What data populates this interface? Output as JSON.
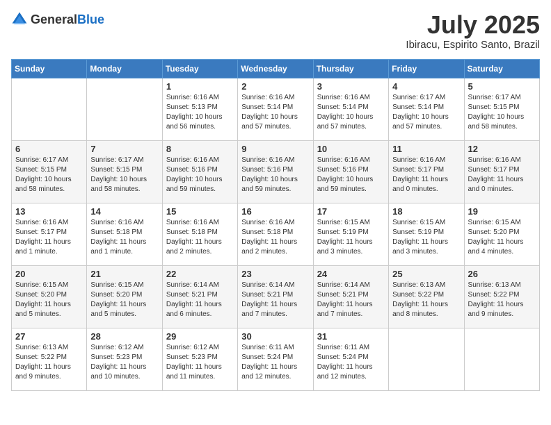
{
  "header": {
    "logo_general": "General",
    "logo_blue": "Blue",
    "month": "July 2025",
    "location": "Ibiracu, Espirito Santo, Brazil"
  },
  "weekdays": [
    "Sunday",
    "Monday",
    "Tuesday",
    "Wednesday",
    "Thursday",
    "Friday",
    "Saturday"
  ],
  "weeks": [
    [
      {
        "day": "",
        "info": ""
      },
      {
        "day": "",
        "info": ""
      },
      {
        "day": "1",
        "info": "Sunrise: 6:16 AM\nSunset: 5:13 PM\nDaylight: 10 hours and 56 minutes."
      },
      {
        "day": "2",
        "info": "Sunrise: 6:16 AM\nSunset: 5:14 PM\nDaylight: 10 hours and 57 minutes."
      },
      {
        "day": "3",
        "info": "Sunrise: 6:16 AM\nSunset: 5:14 PM\nDaylight: 10 hours and 57 minutes."
      },
      {
        "day": "4",
        "info": "Sunrise: 6:17 AM\nSunset: 5:14 PM\nDaylight: 10 hours and 57 minutes."
      },
      {
        "day": "5",
        "info": "Sunrise: 6:17 AM\nSunset: 5:15 PM\nDaylight: 10 hours and 58 minutes."
      }
    ],
    [
      {
        "day": "6",
        "info": "Sunrise: 6:17 AM\nSunset: 5:15 PM\nDaylight: 10 hours and 58 minutes."
      },
      {
        "day": "7",
        "info": "Sunrise: 6:17 AM\nSunset: 5:15 PM\nDaylight: 10 hours and 58 minutes."
      },
      {
        "day": "8",
        "info": "Sunrise: 6:16 AM\nSunset: 5:16 PM\nDaylight: 10 hours and 59 minutes."
      },
      {
        "day": "9",
        "info": "Sunrise: 6:16 AM\nSunset: 5:16 PM\nDaylight: 10 hours and 59 minutes."
      },
      {
        "day": "10",
        "info": "Sunrise: 6:16 AM\nSunset: 5:16 PM\nDaylight: 10 hours and 59 minutes."
      },
      {
        "day": "11",
        "info": "Sunrise: 6:16 AM\nSunset: 5:17 PM\nDaylight: 11 hours and 0 minutes."
      },
      {
        "day": "12",
        "info": "Sunrise: 6:16 AM\nSunset: 5:17 PM\nDaylight: 11 hours and 0 minutes."
      }
    ],
    [
      {
        "day": "13",
        "info": "Sunrise: 6:16 AM\nSunset: 5:17 PM\nDaylight: 11 hours and 1 minute."
      },
      {
        "day": "14",
        "info": "Sunrise: 6:16 AM\nSunset: 5:18 PM\nDaylight: 11 hours and 1 minute."
      },
      {
        "day": "15",
        "info": "Sunrise: 6:16 AM\nSunset: 5:18 PM\nDaylight: 11 hours and 2 minutes."
      },
      {
        "day": "16",
        "info": "Sunrise: 6:16 AM\nSunset: 5:18 PM\nDaylight: 11 hours and 2 minutes."
      },
      {
        "day": "17",
        "info": "Sunrise: 6:15 AM\nSunset: 5:19 PM\nDaylight: 11 hours and 3 minutes."
      },
      {
        "day": "18",
        "info": "Sunrise: 6:15 AM\nSunset: 5:19 PM\nDaylight: 11 hours and 3 minutes."
      },
      {
        "day": "19",
        "info": "Sunrise: 6:15 AM\nSunset: 5:20 PM\nDaylight: 11 hours and 4 minutes."
      }
    ],
    [
      {
        "day": "20",
        "info": "Sunrise: 6:15 AM\nSunset: 5:20 PM\nDaylight: 11 hours and 5 minutes."
      },
      {
        "day": "21",
        "info": "Sunrise: 6:15 AM\nSunset: 5:20 PM\nDaylight: 11 hours and 5 minutes."
      },
      {
        "day": "22",
        "info": "Sunrise: 6:14 AM\nSunset: 5:21 PM\nDaylight: 11 hours and 6 minutes."
      },
      {
        "day": "23",
        "info": "Sunrise: 6:14 AM\nSunset: 5:21 PM\nDaylight: 11 hours and 7 minutes."
      },
      {
        "day": "24",
        "info": "Sunrise: 6:14 AM\nSunset: 5:21 PM\nDaylight: 11 hours and 7 minutes."
      },
      {
        "day": "25",
        "info": "Sunrise: 6:13 AM\nSunset: 5:22 PM\nDaylight: 11 hours and 8 minutes."
      },
      {
        "day": "26",
        "info": "Sunrise: 6:13 AM\nSunset: 5:22 PM\nDaylight: 11 hours and 9 minutes."
      }
    ],
    [
      {
        "day": "27",
        "info": "Sunrise: 6:13 AM\nSunset: 5:22 PM\nDaylight: 11 hours and 9 minutes."
      },
      {
        "day": "28",
        "info": "Sunrise: 6:12 AM\nSunset: 5:23 PM\nDaylight: 11 hours and 10 minutes."
      },
      {
        "day": "29",
        "info": "Sunrise: 6:12 AM\nSunset: 5:23 PM\nDaylight: 11 hours and 11 minutes."
      },
      {
        "day": "30",
        "info": "Sunrise: 6:11 AM\nSunset: 5:24 PM\nDaylight: 11 hours and 12 minutes."
      },
      {
        "day": "31",
        "info": "Sunrise: 6:11 AM\nSunset: 5:24 PM\nDaylight: 11 hours and 12 minutes."
      },
      {
        "day": "",
        "info": ""
      },
      {
        "day": "",
        "info": ""
      }
    ]
  ]
}
